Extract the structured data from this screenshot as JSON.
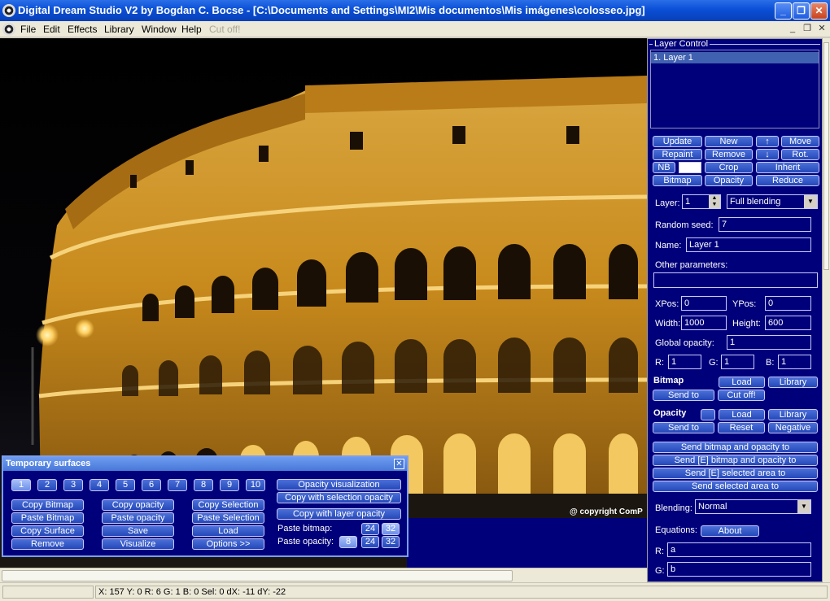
{
  "window": {
    "title": "Digital Dream Studio V2 by Bogdan C. Bocse - [C:\\Documents and Settings\\MI2\\Mis documentos\\Mis imágenes\\colosseo.jpg]",
    "minimize": "_",
    "maximize": "❐",
    "close": "✕"
  },
  "menu": {
    "items": [
      "File",
      "Edit",
      "Effects",
      "Library",
      "Window",
      "Help",
      "Cut off!"
    ],
    "mdi_minimize": "_",
    "mdi_restore": "❐",
    "mdi_close": "✕"
  },
  "canvas": {
    "copyright": "@ copyright ComP"
  },
  "layer_control": {
    "title": "Layer Control",
    "layers": [
      "1. Layer 1"
    ],
    "buttons": {
      "update": "Update",
      "new": "New",
      "up": "↑",
      "move": "Move",
      "repaint": "Repaint",
      "remove": "Remove",
      "down": "↓",
      "rot": "Rot.",
      "nb": "NB",
      "crop": "Crop",
      "inherit": "Inherit",
      "bitmap": "Bitmap",
      "opacity": "Opacity",
      "reduce": "Reduce"
    },
    "layer_label": "Layer:",
    "layer_value": "1",
    "blending_mode": "Full blending",
    "random_seed_label": "Random seed:",
    "random_seed": "7",
    "name_label": "Name:",
    "name": "Layer 1",
    "other_params_label": "Other parameters:",
    "other_params": "",
    "xpos_label": "XPos:",
    "xpos": "0",
    "ypos_label": "YPos:",
    "ypos": "0",
    "width_label": "Width:",
    "width": "1000",
    "height_label": "Height:",
    "height": "600",
    "global_opacity_label": "Global opacity:",
    "global_opacity": "1",
    "r_label": "R:",
    "r": "1",
    "g_label": "G:",
    "g": "1",
    "b_label": "B:",
    "b": "1",
    "bitmap_section": "Bitmap",
    "bitmap_load": "Load",
    "bitmap_library": "Library",
    "bitmap_send_to": "Send to",
    "bitmap_cut_off": "Cut off!",
    "opacity_section": "Opacity",
    "opacity_load": "Load",
    "opacity_library": "Library",
    "opacity_send_to": "Send to",
    "opacity_reset": "Reset",
    "opacity_negative": "Negative",
    "send_bitmap_opacity": "Send bitmap and opacity to",
    "send_e_bitmap_opacity": "Send [E] bitmap and opacity to",
    "send_e_selected": "Send [E] selected area to",
    "send_selected": "Send selected area to",
    "blending_label": "Blending:",
    "blending": "Normal",
    "equations_label": "Equations:",
    "about": "About",
    "eq_r_label": "R:",
    "eq_r": "a",
    "eq_g_label": "G:",
    "eq_g": "b"
  },
  "temp_surfaces": {
    "title": "Temporary surfaces",
    "close": "✕",
    "numbers": [
      "1",
      "2",
      "3",
      "4",
      "5",
      "6",
      "7",
      "8",
      "9",
      "10"
    ],
    "selected_number": "1",
    "col1": [
      "Copy Bitmap",
      "Paste Bitmap",
      "Copy Surface",
      "Remove"
    ],
    "col2": [
      "Copy opacity",
      "Paste opacity",
      "Save",
      "Visualize"
    ],
    "col3": [
      "Copy Selection",
      "Paste Selection",
      "Load",
      "Options >>"
    ],
    "opacity_visualization": "Opacity visualization",
    "copy_with_selection_opacity": "Copy with selection opacity",
    "copy_with_layer_opacity": "Copy with layer opacity",
    "paste_bitmap_label": "Paste bitmap:",
    "paste_bitmap_opts": [
      "24",
      "32"
    ],
    "paste_opacity_label": "Paste opacity:",
    "paste_opacity_opts": [
      "8",
      "24",
      "32"
    ]
  },
  "status": {
    "text": "X: 157 Y: 0 R: 6 G: 1 B: 0 Sel: 0 dX: -11 dY: -22"
  },
  "colors": {
    "panel_bg": "#00007a",
    "button": "#3458c8",
    "title_bar": "#0a4fd6",
    "building": "#c88a1c"
  }
}
